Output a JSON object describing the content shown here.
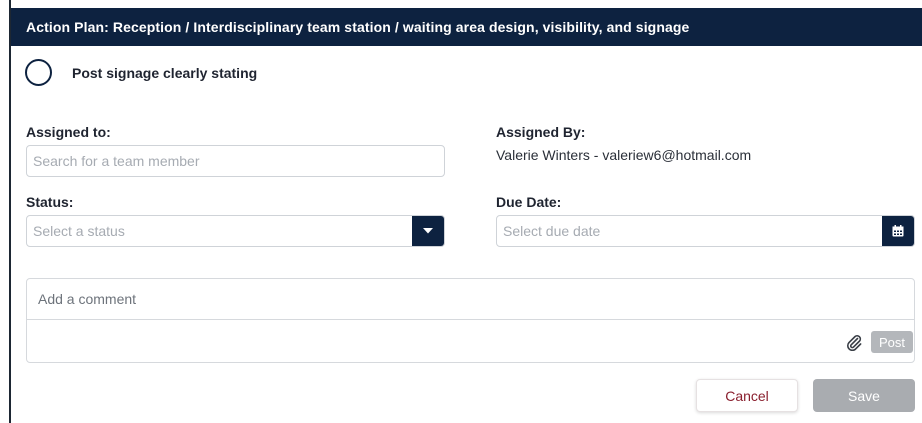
{
  "header": {
    "title": "Action Plan: Reception / Interdisciplinary team station / waiting area design, visibility, and signage"
  },
  "task": {
    "title": "Post signage clearly stating"
  },
  "assigned_to": {
    "label": "Assigned to:",
    "value": "",
    "placeholder": "Search for a team member"
  },
  "assigned_by": {
    "label": "Assigned By:",
    "value": "Valerie Winters - valeriew6@hotmail.com"
  },
  "status": {
    "label": "Status:",
    "placeholder": "Select a status"
  },
  "due_date": {
    "label": "Due Date:",
    "value": "",
    "placeholder": "Select due date"
  },
  "comment": {
    "value": "",
    "placeholder": "Add a comment",
    "post_label": "Post"
  },
  "actions": {
    "cancel_label": "Cancel",
    "save_label": "Save"
  },
  "icons": {
    "status_toggle": "chevron-down-icon",
    "due_date_picker": "calendar-icon",
    "attach": "paperclip-icon",
    "task_status": "circle-icon"
  },
  "colors": {
    "header_bg": "#0d2240",
    "accent": "#0d2240",
    "cancel_text": "#8a1f2e",
    "disabled_button": "#a9acb0"
  }
}
